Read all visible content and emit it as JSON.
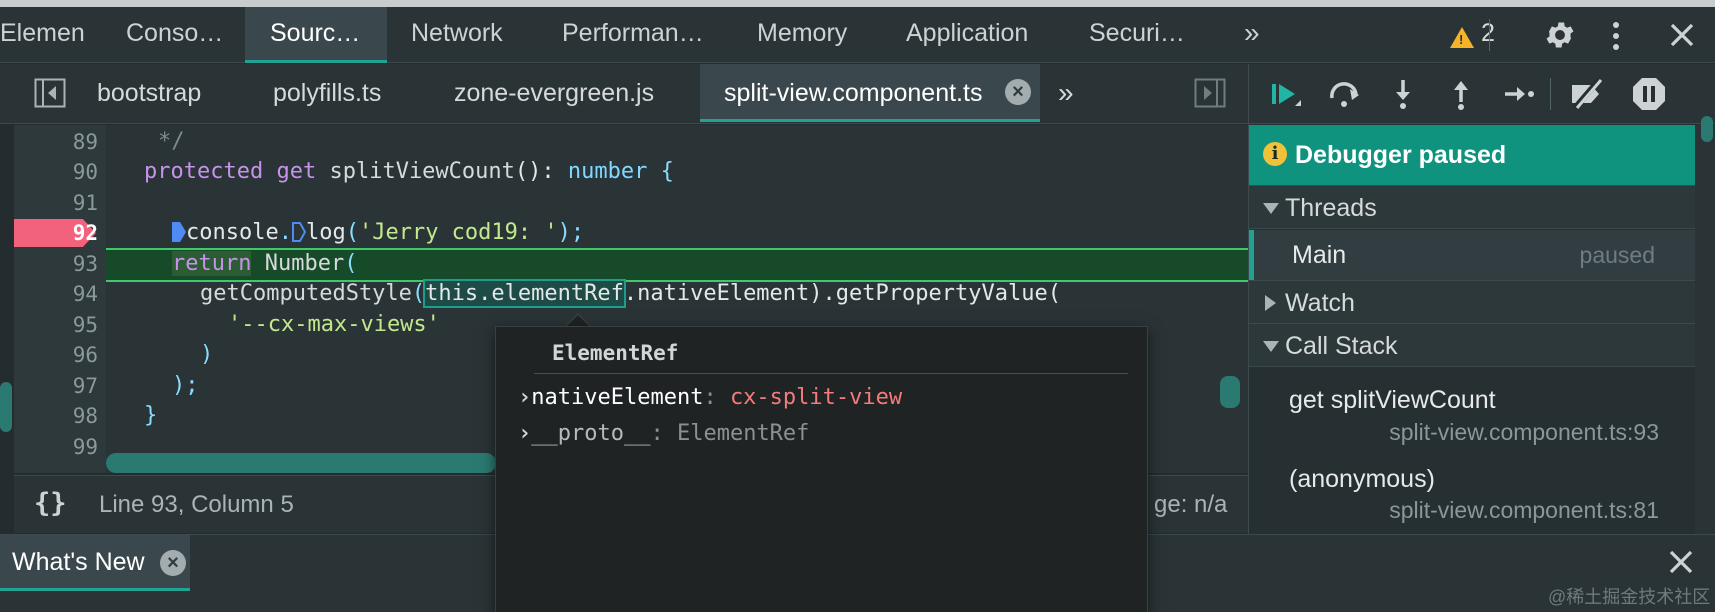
{
  "main_tabs": [
    {
      "label": "Elemen…"
    },
    {
      "label": "Conso…"
    },
    {
      "label": "Sourc…"
    },
    {
      "label": "Network"
    },
    {
      "label": "Performan…"
    },
    {
      "label": "Memory"
    },
    {
      "label": "Application"
    },
    {
      "label": "Securi…"
    }
  ],
  "more_tabs_glyph": "»",
  "warnings": {
    "count": "2",
    "color": "#f5b22b"
  },
  "file_tabs": [
    {
      "label": "bootstrap"
    },
    {
      "label": "polyfills.ts"
    },
    {
      "label": "zone-evergreen.js"
    },
    {
      "label": "split-view.component.ts"
    }
  ],
  "editor": {
    "line_numbers": [
      "89",
      "90",
      "91",
      "92",
      "93",
      "94",
      "95",
      "96",
      "97",
      "98",
      "99"
    ],
    "breakpoint_line": "92",
    "execution_line": "93",
    "code": {
      "l89": "*/",
      "l90_kw1": "protected",
      "l90_kw2": "get",
      "l90_fn": "splitViewCount",
      "l90_p1": "():",
      "l90_type": "number",
      "l90_brace": "{",
      "l92_obj": "console",
      "l92_dot": ".",
      "l92_fn": "log",
      "l92_open": "(",
      "l92_str": "'Jerry cod19: '",
      "l92_close": ");",
      "l93_kw": "return",
      "l93_fn": "Number",
      "l93_open": "(",
      "l94_fn": "getComputedStyle",
      "l94_open": "(",
      "l94_hl": "this.elementRef",
      "l94_rest": ".nativeElement).getPropertyValue(",
      "l95_str": "'--cx-max-views'",
      "l96": ")",
      "l97": ");",
      "l98": "}"
    }
  },
  "status_bar": {
    "format_icon": "{}",
    "position": "Line 93, Column 5",
    "coverage": "ge: n/a"
  },
  "drawer": {
    "tab_label": "What's New",
    "watermark": "@稀土掘金技术社区"
  },
  "debugger": {
    "paused_label": "Debugger paused",
    "info_glyph": "i",
    "threads_label": "Threads",
    "thread_name": "Main",
    "thread_status": "paused",
    "watch_label": "Watch",
    "callstack_label": "Call Stack",
    "frames": [
      {
        "name": "get splitViewCount",
        "location": "split-view.component.ts:93"
      },
      {
        "name": "(anonymous)",
        "location": "split-view.component.ts:81"
      }
    ]
  },
  "popover": {
    "header": "ElementRef",
    "rows": [
      {
        "chevron": "›",
        "key": "nativeElement",
        "colon": ":",
        "value": "cx-split-view"
      },
      {
        "chevron": "›",
        "key": "__proto__",
        "colon": ":",
        "value": "ElementRef"
      }
    ]
  },
  "colors": {
    "accent": "#21a393",
    "breakpoint": "#f2627c",
    "paused_banner": "#10937e",
    "exec_line": "#174a28"
  }
}
